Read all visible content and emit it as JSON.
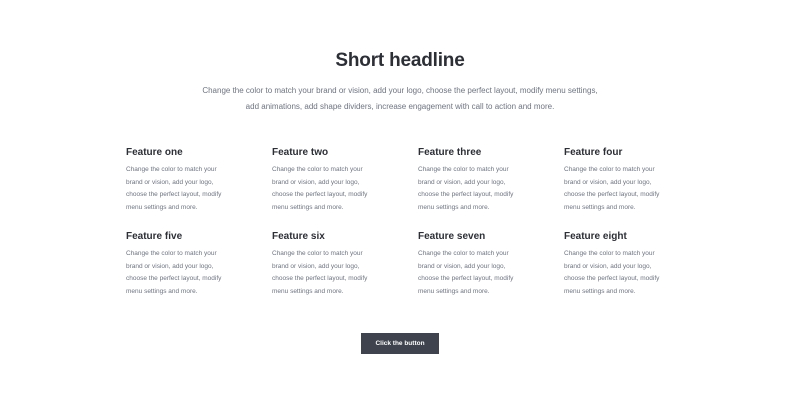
{
  "headline": "Short headline",
  "subtext": "Change the color to match your brand or vision, add your logo, choose the perfect layout, modify menu settings, add animations, add shape dividers, increase engagement with call to action and more.",
  "features": [
    {
      "title": "Feature one",
      "desc": "Change the color to match your brand or vision, add your logo, choose the perfect layout, modify menu settings and more."
    },
    {
      "title": "Feature two",
      "desc": "Change the color to match your brand or vision, add your logo, choose the perfect layout, modify menu settings and more."
    },
    {
      "title": "Feature three",
      "desc": "Change the color to match your brand or vision, add your logo, choose the perfect layout, modify menu settings and more."
    },
    {
      "title": "Feature four",
      "desc": "Change the color to match your brand or vision, add your logo, choose the perfect layout, modify menu settings and more."
    },
    {
      "title": "Feature five",
      "desc": "Change the color to match your brand or vision, add your logo, choose the perfect layout, modify menu settings and more."
    },
    {
      "title": "Feature six",
      "desc": "Change the color to match your brand or vision, add your logo, choose the perfect layout, modify menu settings and more."
    },
    {
      "title": "Feature seven",
      "desc": "Change the color to match your brand or vision, add your logo, choose the perfect layout, modify menu settings and more."
    },
    {
      "title": "Feature eight",
      "desc": "Change the color to match your brand or vision, add your logo, choose the perfect layout, modify menu settings and more."
    }
  ],
  "cta": {
    "label": "Click the button"
  },
  "colors": {
    "background": "#ffffff",
    "text": "#2c2f36",
    "muted": "#6e7480",
    "button": "#3e434d"
  }
}
